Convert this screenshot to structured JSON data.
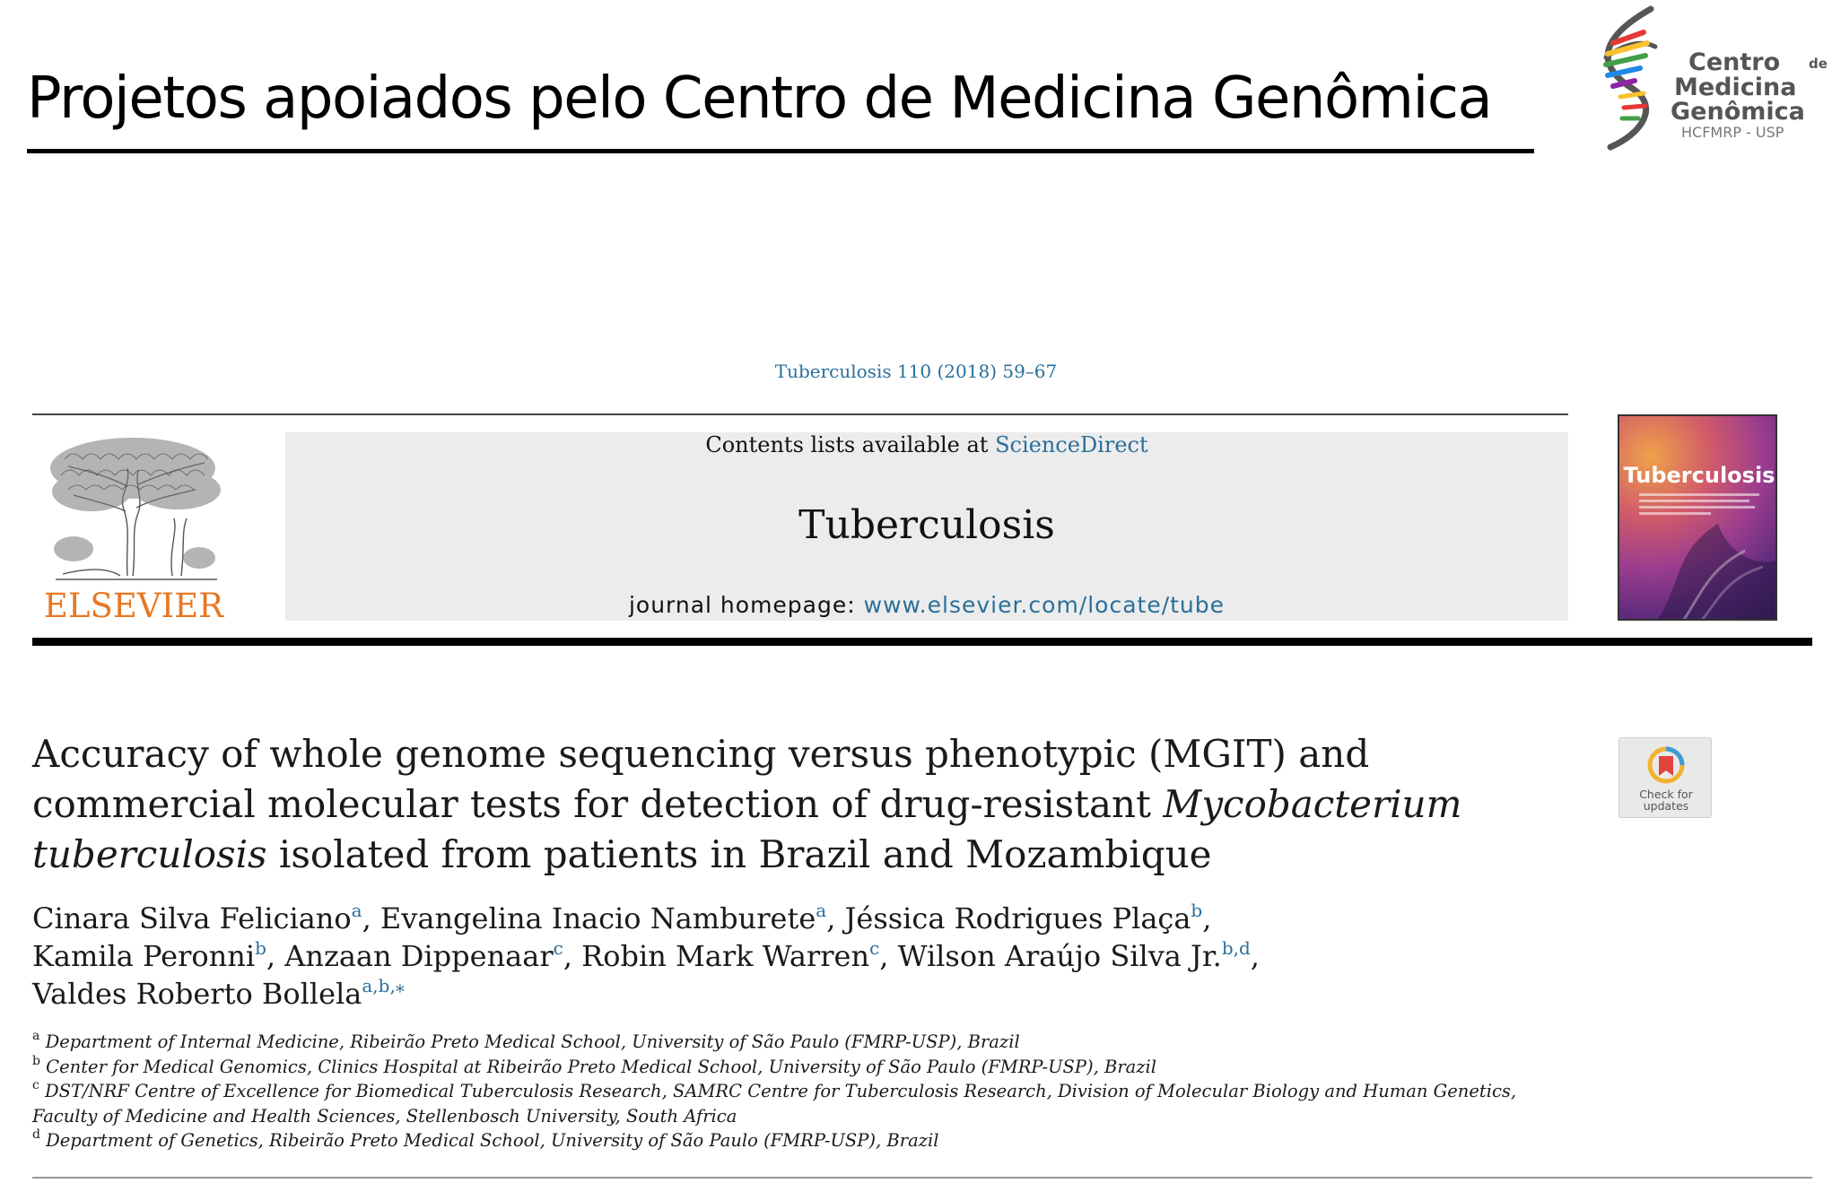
{
  "slide": {
    "title": "Projetos apoiados pelo Centro de Medicina Genômica"
  },
  "cmg_logo": {
    "line1": "Centro",
    "line1_small": "de",
    "line2": "Medicina",
    "line3": "Genômica",
    "line4": "HCFMRP - USP"
  },
  "article": {
    "citation": "Tuberculosis 110 (2018) 59–67",
    "contents_prefix": "Contents lists available at ",
    "contents_link": "ScienceDirect",
    "journal_name": "Tuberculosis",
    "homepage_prefix": "journal homepage: ",
    "homepage_url": "www.elsevier.com/locate/tube",
    "publisher_logo": "ELSEVIER",
    "cover_title": "Tuberculosis",
    "check_updates": {
      "line1": "Check for",
      "line2": "updates"
    },
    "title": {
      "l1": "Accuracy of whole genome sequencing versus phenotypic (MGIT) and",
      "l2_a": "commercial molecular tests for detection of drug-resistant ",
      "l2_b": "Mycobacterium",
      "l3_a": "tuberculosis",
      "l3_b": " isolated from patients in Brazil and Mozambique"
    },
    "authors": [
      {
        "name": "Cinara Silva Feliciano",
        "sup": "a",
        "sep": ", "
      },
      {
        "name": "Evangelina Inacio Namburete",
        "sup": "a",
        "sep": ", "
      },
      {
        "name": "Jéssica Rodrigues Plaça",
        "sup": "b",
        "sep": ","
      },
      {
        "name": "Kamila Peronni",
        "sup": "b",
        "sep": ", "
      },
      {
        "name": "Anzaan Dippenaar",
        "sup": "c",
        "sep": ", "
      },
      {
        "name": "Robin Mark Warren",
        "sup": "c",
        "sep": ", "
      },
      {
        "name": "Wilson Araújo Silva Jr.",
        "sup": "b,d",
        "sep": ","
      },
      {
        "name": "Valdes Roberto Bollela",
        "sup": "a,b,⁎",
        "sep": ""
      }
    ],
    "affiliations": {
      "a": {
        "label": "a",
        "text": "Department of Internal Medicine, Ribeirão Preto Medical School, University of São Paulo (FMRP-USP), Brazil"
      },
      "b": {
        "label": "b",
        "text": "Center for Medical Genomics, Clinics Hospital at Ribeirão Preto Medical School, University of São Paulo (FMRP-USP), Brazil"
      },
      "c": {
        "label": "c",
        "text": "DST/NRF Centre of Excellence for Biomedical Tuberculosis Research, SAMRC Centre for Tuberculosis Research, Division of Molecular Biology and Human Genetics,",
        "text2": "Faculty of Medicine and Health Sciences, Stellenbosch University, South Africa"
      },
      "d": {
        "label": "d",
        "text": "Department of Genetics, Ribeirão Preto Medical School, University of São Paulo (FMRP-USP), Brazil"
      }
    }
  }
}
